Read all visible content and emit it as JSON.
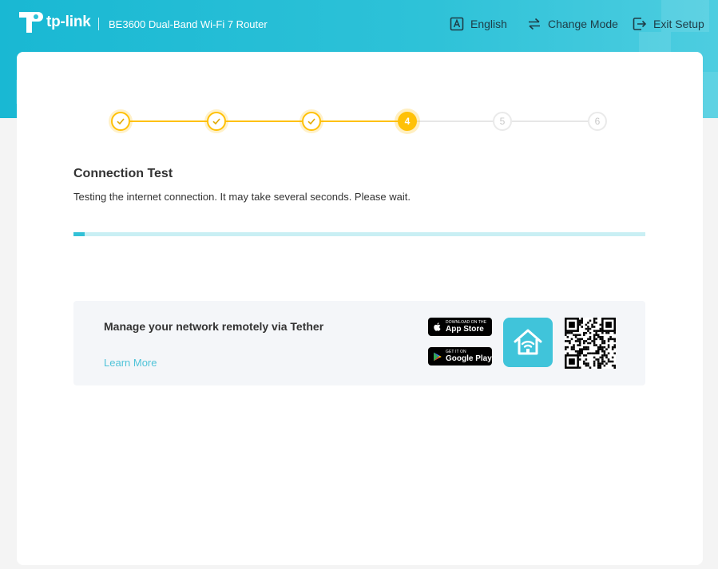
{
  "header": {
    "brand": "tp-link",
    "product": "BE3600 Dual-Band Wi-Fi 7 Router",
    "nav": {
      "language": "English",
      "change_mode": "Change Mode",
      "exit_setup": "Exit Setup"
    }
  },
  "stepper": {
    "steps": [
      {
        "label": "",
        "state": "done"
      },
      {
        "label": "",
        "state": "done"
      },
      {
        "label": "",
        "state": "done"
      },
      {
        "label": "4",
        "state": "active"
      },
      {
        "label": "5",
        "state": "todo"
      },
      {
        "label": "6",
        "state": "todo"
      }
    ]
  },
  "content": {
    "title": "Connection Test",
    "description": "Testing the internet connection. It may take several seconds. Please wait.",
    "progress_percent": 2
  },
  "tether": {
    "title": "Manage your network remotely via Tether",
    "learn_more": "Learn More",
    "app_store": {
      "small": "DOWNLOAD ON THE",
      "big": "App Store"
    },
    "google_play": {
      "small": "GET IT ON",
      "big": "Google Play"
    }
  },
  "colors": {
    "brand": "#19b8d3",
    "accent": "#ffc107",
    "link": "#4fc3d8",
    "progress": "#33c1d7",
    "progress_track": "#c9eff4"
  }
}
